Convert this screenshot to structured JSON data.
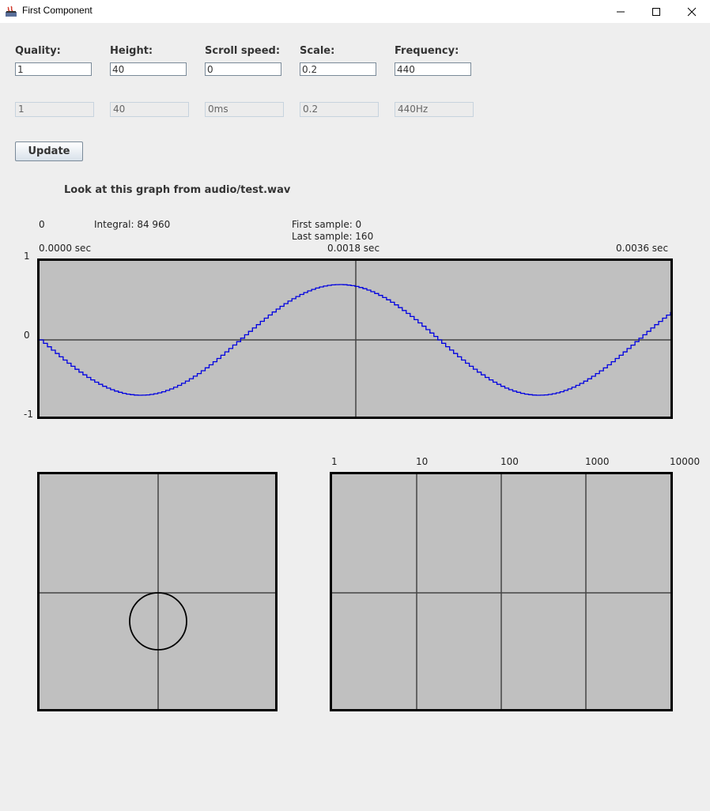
{
  "window": {
    "title": "First Component"
  },
  "controls": {
    "fields": [
      {
        "label": "Quality:",
        "value": "1",
        "display": "1"
      },
      {
        "label": "Height:",
        "value": "40",
        "display": "40"
      },
      {
        "label": "Scroll speed:",
        "value": "0",
        "display": "0ms"
      },
      {
        "label": "Scale:",
        "value": "0.2",
        "display": "0.2"
      },
      {
        "label": "Frequency:",
        "value": "440",
        "display": "440Hz"
      }
    ],
    "update_label": "Update"
  },
  "heading": "Look at this graph from audio/test.wav",
  "waveform": {
    "position": "0",
    "integral": "Integral: 84 960",
    "first_sample": "First sample: 0",
    "last_sample": "Last sample: 160",
    "time_labels": [
      "0.0000 sec",
      "0.0018 sec",
      "0.0036 sec"
    ],
    "y_labels": [
      "1",
      "0",
      "-1"
    ]
  },
  "spectrum": {
    "x_labels": [
      "1",
      "10",
      "100",
      "1000",
      "10000"
    ]
  },
  "colors": {
    "panel_bg": "#c0c0c0",
    "wave": "#0000e0",
    "grid": "#444444"
  },
  "chart_data": [
    {
      "type": "line",
      "x_unit": "sec",
      "x_range": [
        0.0,
        0.0036
      ],
      "ylim": [
        -1,
        1
      ],
      "frequency_hz": 440,
      "amplitude": 0.7,
      "samples": 160,
      "x_ticks": [
        "0.0000 sec",
        "0.0018 sec",
        "0.0036 sec"
      ],
      "y_ticks": [
        "1",
        "0",
        "-1"
      ]
    },
    {
      "type": "scatter",
      "shape": "circle"
    },
    {
      "type": "line",
      "x_scale": "log",
      "x_ticks": [
        "1",
        "10",
        "100",
        "1000",
        "10000"
      ]
    }
  ]
}
